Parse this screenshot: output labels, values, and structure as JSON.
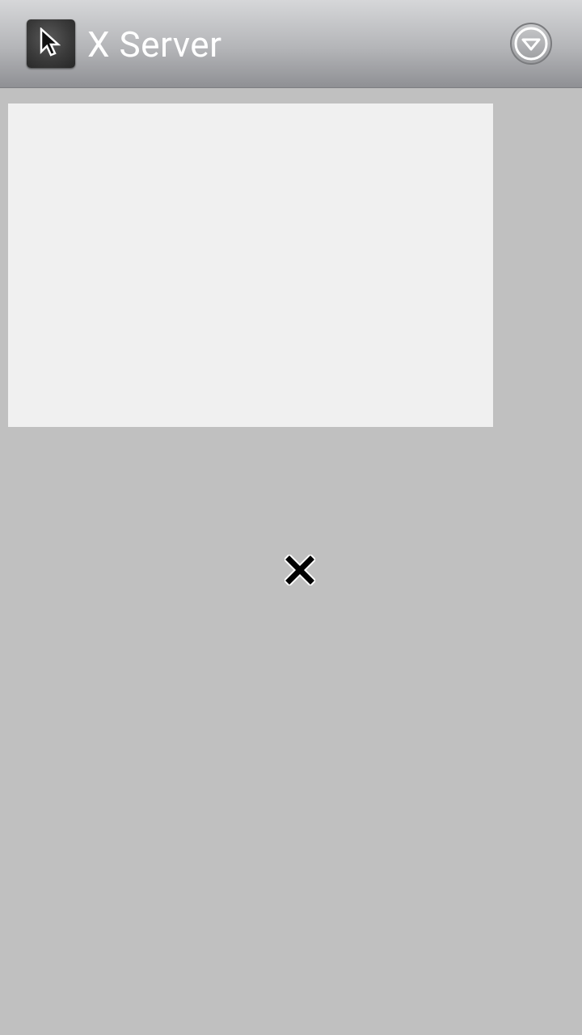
{
  "app_bar": {
    "title": "X Server",
    "app_icon": "cursor-arrow-icon",
    "overflow_icon": "dropdown-circle-icon"
  },
  "workspace": {
    "root_background": "#c0c0c0",
    "window_background": "#f0f0f0",
    "pointer": "x-cursor-icon"
  }
}
